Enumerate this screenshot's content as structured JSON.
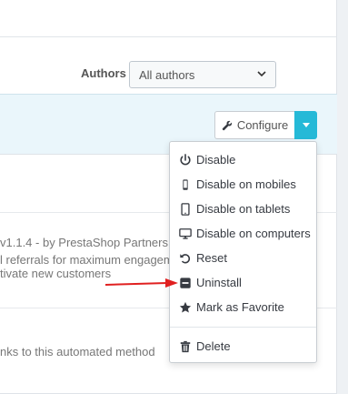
{
  "filter": {
    "authors_label": "Authors",
    "authors_value": "All authors"
  },
  "module_actions": {
    "configure_label": "Configure"
  },
  "dropdown": {
    "items": [
      {
        "label": "Disable",
        "icon": "power-icon"
      },
      {
        "label": "Disable on mobiles",
        "icon": "mobile-icon"
      },
      {
        "label": "Disable on tablets",
        "icon": "tablet-icon"
      },
      {
        "label": "Disable on computers",
        "icon": "desktop-icon"
      },
      {
        "label": "Reset",
        "icon": "undo-icon"
      },
      {
        "label": "Uninstall",
        "icon": "minus-square-icon"
      },
      {
        "label": "Mark as Favorite",
        "icon": "star-icon"
      },
      {
        "label": "Delete",
        "icon": "trash-icon"
      }
    ]
  },
  "modules": {
    "version_line": "v1.1.4 - by PrestaShop Partners",
    "desc_line1": "l referrals for maximum engagem",
    "desc_line2": "tivate new customers",
    "desc_line3": "nks to this automated method"
  },
  "colors": {
    "accent": "#25b9d7",
    "annotation_arrow": "#e02020"
  }
}
